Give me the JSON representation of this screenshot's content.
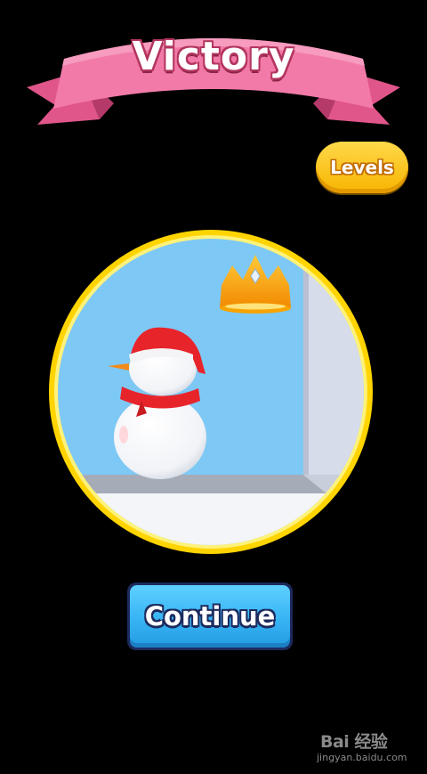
{
  "banner": {
    "title": "Victory",
    "color": "#f06fa0"
  },
  "levels_button": {
    "label": "Levels",
    "color": "#f7b500"
  },
  "scene": {
    "character": "snowman-icon",
    "reward": "crown-icon",
    "frame_color": "#ffd400",
    "sky_color": "#7ec8f5"
  },
  "continue_button": {
    "label": "Continue",
    "color": "#37b4f4"
  },
  "watermark": {
    "brand": "Bai 经验",
    "url": "jingyan.baidu.com"
  }
}
